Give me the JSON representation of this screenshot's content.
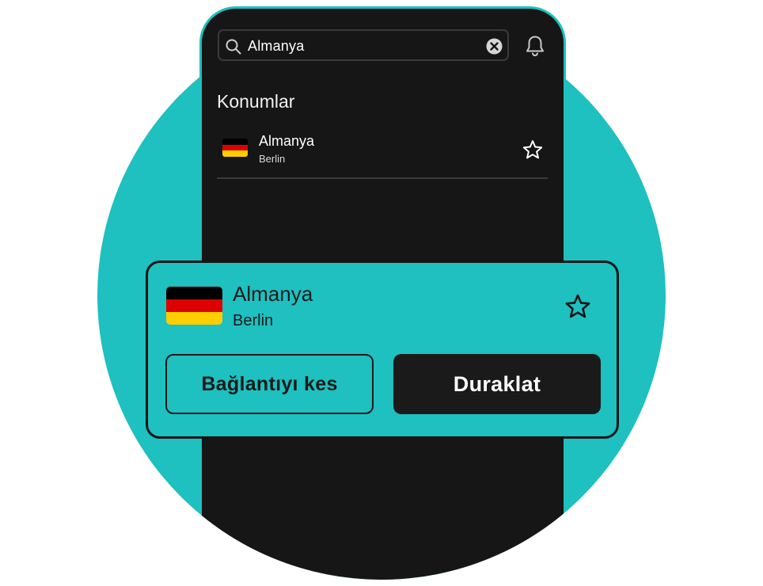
{
  "colors": {
    "teal": "#1ec0c0",
    "dark": "#161616",
    "flag_black": "#000000",
    "flag_red": "#dd0000",
    "flag_gold": "#ffce00"
  },
  "search": {
    "value": "Almanya",
    "icon": "search-icon",
    "clear_icon": "close-circle-icon"
  },
  "header": {
    "bell_icon": "bell-icon"
  },
  "locations": {
    "title": "Konumlar",
    "items": [
      {
        "name": "Almanya",
        "city": "Berlin",
        "flag": "germany-flag-icon",
        "favorite_icon": "star-icon"
      }
    ]
  },
  "card": {
    "country": "Almanya",
    "city": "Berlin",
    "flag": "germany-flag-icon",
    "favorite_icon": "star-icon",
    "disconnect_label": "Bağlantıyı kes",
    "pause_label": "Duraklat"
  }
}
